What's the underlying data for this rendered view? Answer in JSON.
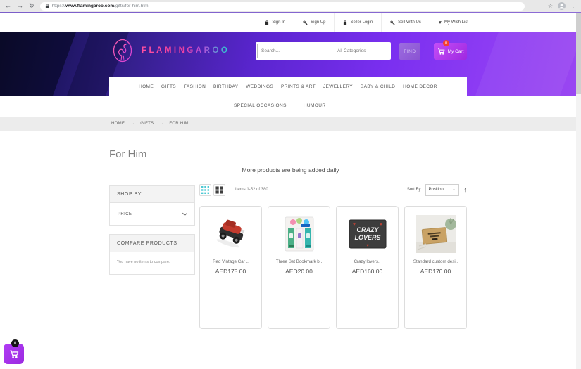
{
  "browser": {
    "url_scheme": "https://",
    "url_domain": "www.flamingaroo.com",
    "url_path": "/gifts/for-him.html"
  },
  "icons": {
    "back": "←",
    "forward": "→",
    "reload": "↻",
    "star": "☆",
    "menu": "⋮",
    "heart": "♥",
    "caret_down": "▼",
    "sort_asc": "↑",
    "breadcrumb_sep": "→"
  },
  "utility_bar": {
    "items": [
      {
        "icon": "lock-icon",
        "label": "Sign In"
      },
      {
        "icon": "key-icon",
        "label": "Sign Up"
      },
      {
        "icon": "lock-icon",
        "label": "Seller Login"
      },
      {
        "icon": "key-icon",
        "label": "Sell With Us"
      },
      {
        "icon": "heart-icon",
        "label": "My Wish List"
      }
    ]
  },
  "header": {
    "brand": "FLAMINGAROO",
    "search_placeholder": "Search...",
    "category_selected": "All Categories",
    "find_label": "FIND",
    "cart_label": "My Cart",
    "cart_count": "0"
  },
  "nav": {
    "primary": [
      "HOME",
      "GIFTS",
      "FASHION",
      "BIRTHDAY",
      "WEDDINGS",
      "PRINTS & ART",
      "JEWELLERY",
      "BABY & CHILD",
      "HOME DECOR"
    ],
    "secondary": [
      "SPECIAL OCCASIONS",
      "HUMOUR"
    ]
  },
  "breadcrumb": [
    "HOME",
    "GIFTS",
    "FOR HIM"
  ],
  "page": {
    "title": "For Him",
    "note": "More products are being added daily"
  },
  "toolbar": {
    "items_count": "Items 1-52 of 380",
    "sort_label": "Sort By",
    "sort_selected": "Position"
  },
  "sidebar": {
    "shop_by_title": "SHOP BY",
    "price_filter": "PRICE",
    "compare_title": "COMPARE PRODUCTS",
    "compare_empty": "You have no items to compare."
  },
  "products": [
    {
      "title": "Red Vintage Car ..",
      "price": "AED175.00"
    },
    {
      "title": "Three Set Bookmark b..",
      "price": "AED20.00"
    },
    {
      "title": "Crazy lovers..",
      "price": "AED160.00",
      "image_text_line1": "CRAZY",
      "image_text_line2": "LOVERS"
    },
    {
      "title": "Standard custom desi..",
      "price": "AED170.00"
    }
  ],
  "floating_cart": {
    "count": "0"
  },
  "colors": {
    "header_purple": "#7a2ff0",
    "header_dark": "#12102f",
    "cart_button_purple": "#ab2fe8",
    "badge_red": "#f4402f",
    "brand_pink": "#ff4fa0",
    "brand_cyan": "#23d3cf",
    "grid_icon_teal": "#4ec9d4",
    "breadcrumb_gray": "#ececec"
  }
}
